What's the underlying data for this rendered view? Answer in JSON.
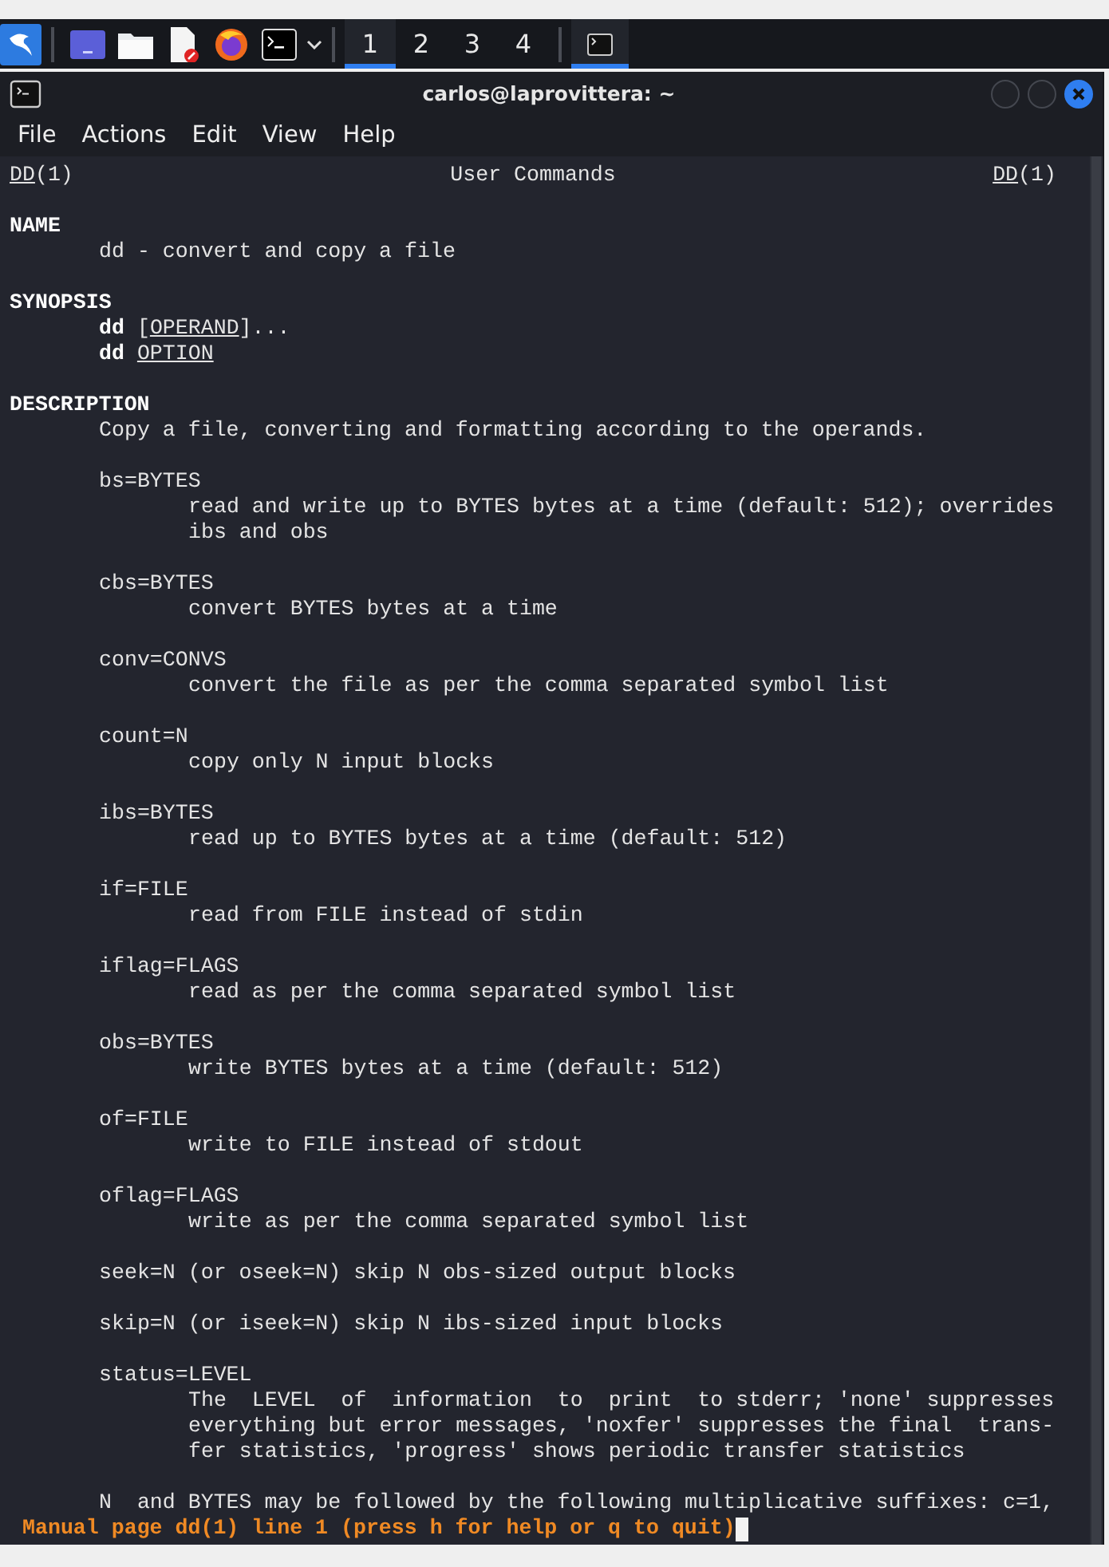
{
  "taskbar": {
    "workspaces": [
      {
        "label": "1",
        "selected": true
      },
      {
        "label": "2",
        "selected": false
      },
      {
        "label": "3",
        "selected": false
      },
      {
        "label": "4",
        "selected": false
      }
    ]
  },
  "window": {
    "title": "carlos@laprovittera: ~"
  },
  "menu": [
    "File",
    "Actions",
    "Edit",
    "View",
    "Help"
  ],
  "header": {
    "left": [
      {
        "text": "DD",
        "underlined": true
      },
      {
        "text": "(1)",
        "underlined": false
      }
    ],
    "center": "User Commands",
    "right": [
      {
        "text": "DD",
        "underlined": true
      },
      {
        "text": "(1)",
        "underlined": false
      }
    ]
  },
  "blocks": [
    [
      {
        "kind": "heading",
        "segments": [
          {
            "text": "NAME",
            "underlined": false
          }
        ]
      },
      {
        "kind": "body",
        "segments": [
          {
            "text": "dd - convert and copy a file",
            "underlined": false
          }
        ]
      }
    ],
    [
      {
        "kind": "heading",
        "segments": [
          {
            "text": "SYNOPSIS",
            "underlined": false
          }
        ]
      },
      {
        "kind": "body",
        "segments": [
          {
            "text": "**dd** [",
            "underlined": false
          },
          {
            "text": "OPERAND",
            "underlined": true
          },
          {
            "text": "]...",
            "underlined": false
          }
        ]
      },
      {
        "kind": "body",
        "segments": [
          {
            "text": "**dd** ",
            "underlined": false
          },
          {
            "text": "OPTION",
            "underlined": true
          }
        ]
      }
    ],
    [
      {
        "kind": "heading",
        "segments": [
          {
            "text": "DESCRIPTION",
            "underlined": false
          }
        ]
      },
      {
        "kind": "body",
        "segments": [
          {
            "text": "Copy a file, converting and formatting according to the operands.",
            "underlined": false
          }
        ]
      }
    ],
    [
      {
        "kind": "body",
        "segments": [
          {
            "text": "bs=BYTES",
            "underlined": false
          }
        ]
      },
      {
        "kind": "detail",
        "segments": [
          {
            "text": "read and write up to BYTES bytes at a time (default: 512); overrides",
            "underlined": false
          }
        ]
      },
      {
        "kind": "detail",
        "segments": [
          {
            "text": "ibs and obs",
            "underlined": false
          }
        ]
      }
    ],
    [
      {
        "kind": "body",
        "segments": [
          {
            "text": "cbs=BYTES",
            "underlined": false
          }
        ]
      },
      {
        "kind": "detail",
        "segments": [
          {
            "text": "convert BYTES bytes at a time",
            "underlined": false
          }
        ]
      }
    ],
    [
      {
        "kind": "body",
        "segments": [
          {
            "text": "conv=CONVS",
            "underlined": false
          }
        ]
      },
      {
        "kind": "detail",
        "segments": [
          {
            "text": "convert the file as per the comma separated symbol list",
            "underlined": false
          }
        ]
      }
    ],
    [
      {
        "kind": "body",
        "segments": [
          {
            "text": "count=N",
            "underlined": false
          }
        ]
      },
      {
        "kind": "detail",
        "segments": [
          {
            "text": "copy only N input blocks",
            "underlined": false
          }
        ]
      }
    ],
    [
      {
        "kind": "body",
        "segments": [
          {
            "text": "ibs=BYTES",
            "underlined": false
          }
        ]
      },
      {
        "kind": "detail",
        "segments": [
          {
            "text": "read up to BYTES bytes at a time (default: 512)",
            "underlined": false
          }
        ]
      }
    ],
    [
      {
        "kind": "body",
        "segments": [
          {
            "text": "if=FILE",
            "underlined": false
          }
        ]
      },
      {
        "kind": "detail",
        "segments": [
          {
            "text": "read from FILE instead of stdin",
            "underlined": false
          }
        ]
      }
    ],
    [
      {
        "kind": "body",
        "segments": [
          {
            "text": "iflag=FLAGS",
            "underlined": false
          }
        ]
      },
      {
        "kind": "detail",
        "segments": [
          {
            "text": "read as per the comma separated symbol list",
            "underlined": false
          }
        ]
      }
    ],
    [
      {
        "kind": "body",
        "segments": [
          {
            "text": "obs=BYTES",
            "underlined": false
          }
        ]
      },
      {
        "kind": "detail",
        "segments": [
          {
            "text": "write BYTES bytes at a time (default: 512)",
            "underlined": false
          }
        ]
      }
    ],
    [
      {
        "kind": "body",
        "segments": [
          {
            "text": "of=FILE",
            "underlined": false
          }
        ]
      },
      {
        "kind": "detail",
        "segments": [
          {
            "text": "write to FILE instead of stdout",
            "underlined": false
          }
        ]
      }
    ],
    [
      {
        "kind": "body",
        "segments": [
          {
            "text": "oflag=FLAGS",
            "underlined": false
          }
        ]
      },
      {
        "kind": "detail",
        "segments": [
          {
            "text": "write as per the comma separated symbol list",
            "underlined": false
          }
        ]
      }
    ],
    [
      {
        "kind": "body",
        "segments": [
          {
            "text": "seek=N (or oseek=N) skip N obs-sized output blocks",
            "underlined": false
          }
        ]
      }
    ],
    [
      {
        "kind": "body",
        "segments": [
          {
            "text": "skip=N (or iseek=N) skip N ibs-sized input blocks",
            "underlined": false
          }
        ]
      }
    ],
    [
      {
        "kind": "body",
        "segments": [
          {
            "text": "status=LEVEL",
            "underlined": false
          }
        ]
      },
      {
        "kind": "detail",
        "segments": [
          {
            "text": "The  LEVEL  of  information  to  print  to stderr; 'none' suppresses",
            "underlined": false
          }
        ]
      },
      {
        "kind": "detail",
        "segments": [
          {
            "text": "everything but error messages, 'noxfer' suppresses the final  trans-",
            "underlined": false
          }
        ]
      },
      {
        "kind": "detail",
        "segments": [
          {
            "text": "fer statistics, 'progress' shows periodic transfer statistics",
            "underlined": false
          }
        ]
      }
    ],
    [
      {
        "kind": "body",
        "segments": [
          {
            "text": "N  and BYTES may be followed by the following multiplicative suffixes: c=1,",
            "underlined": false
          }
        ]
      }
    ]
  ],
  "prompt": "Manual page dd(1) line 1 (press h for help or q to quit)"
}
